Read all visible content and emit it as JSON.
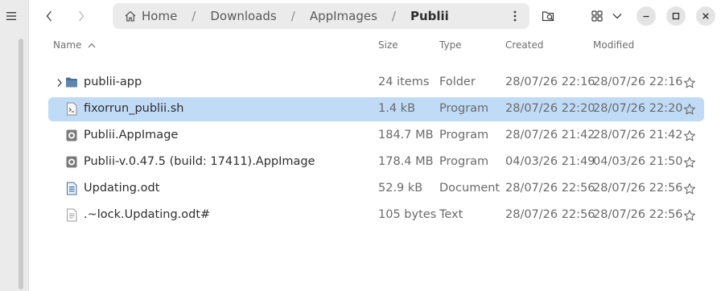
{
  "breadcrumbs": [
    "Home",
    "Downloads",
    "AppImages",
    "Publii"
  ],
  "breadcrumb_separator": "/",
  "columns": {
    "name": "Name",
    "size": "Size",
    "type": "Type",
    "created": "Created",
    "modified": "Modified"
  },
  "sort": {
    "column": "Name",
    "direction": "ascending"
  },
  "files": [
    {
      "name": "publii-app",
      "size": "24 items",
      "type": "Folder",
      "created": "28/07/26 22:16",
      "modified": "28/07/26 22:16",
      "icon": "folder-icon",
      "expandable": true,
      "selected": false
    },
    {
      "name": "fixorrun_publii.sh",
      "size": "1.4 kB",
      "type": "Program",
      "created": "28/07/26 22:20",
      "modified": "28/07/26 22:20",
      "icon": "script-icon",
      "expandable": false,
      "selected": true
    },
    {
      "name": "Publii.AppImage",
      "size": "184.7 MB",
      "type": "Program",
      "created": "28/07/26 21:42",
      "modified": "28/07/26 21:42",
      "icon": "appimage-icon",
      "expandable": false,
      "selected": false
    },
    {
      "name": "Publii-v.0.47.5 (build: 17411).AppImage",
      "size": "178.4 MB",
      "type": "Program",
      "created": "04/03/26 21:49",
      "modified": "04/03/26 21:50",
      "icon": "appimage-icon",
      "expandable": false,
      "selected": false
    },
    {
      "name": "Updating.odt",
      "size": "52.9 kB",
      "type": "Document",
      "created": "28/07/26 22:56",
      "modified": "28/07/26 22:56",
      "icon": "document-icon",
      "expandable": false,
      "selected": false
    },
    {
      "name": ".~lock.Updating.odt#",
      "size": "105 bytes",
      "type": "Text",
      "created": "28/07/26 22:56",
      "modified": "28/07/26 22:56",
      "icon": "text-file-icon",
      "expandable": false,
      "selected": false
    }
  ],
  "colors": {
    "selection": "#c0dbf6",
    "folder": "#4a6f96",
    "pathbar": "#ebebeb",
    "sidebar": "#ebebeb"
  }
}
